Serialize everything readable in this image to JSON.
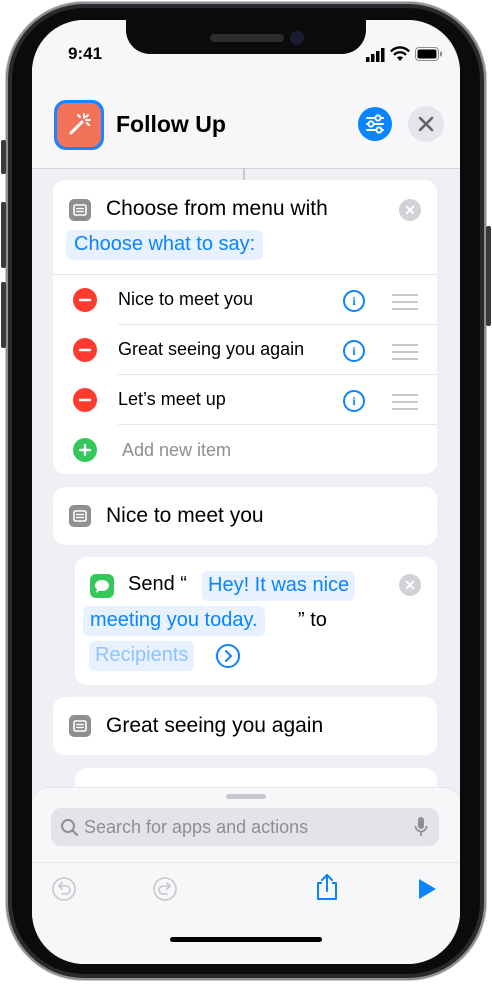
{
  "status_bar": {
    "time": "9:41"
  },
  "header": {
    "title": "Follow Up"
  },
  "menu_block": {
    "title": "Choose from menu with",
    "prompt": "Choose what to say:",
    "items": [
      {
        "label": "Nice to meet you"
      },
      {
        "label": "Great seeing you again"
      },
      {
        "label": "Let’s meet up"
      }
    ],
    "add_item": "Add new item"
  },
  "case_1": {
    "title": "Nice to meet you"
  },
  "send_block": {
    "send_label": "Send",
    "quote_open": "“",
    "message_line1": "Hey! It was nice",
    "message_line2": "meeting you today.",
    "quote_close": "”",
    "to_label": "to",
    "recipients": "Recipients"
  },
  "case_2": {
    "title": "Great seeing you again"
  },
  "search": {
    "placeholder": "Search for apps and actions"
  },
  "colors": {
    "accent": "#0a84ff",
    "delete": "#ff3b30",
    "add": "#34c759",
    "app_icon": "#f2735a"
  }
}
